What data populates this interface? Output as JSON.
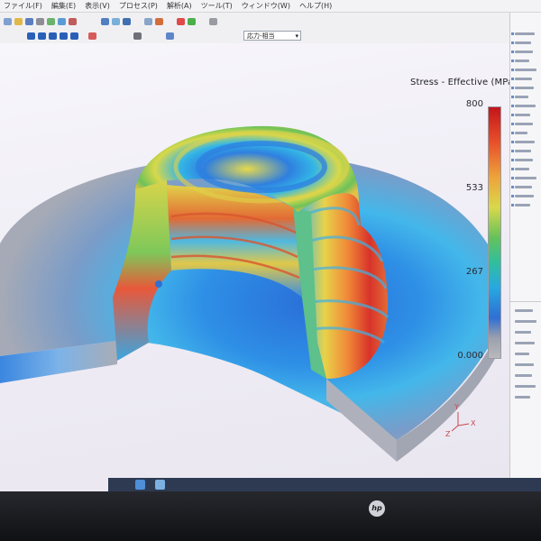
{
  "menu": {
    "items": [
      "ファイル(F)",
      "編集(E)",
      "表示(V)",
      "プロセス(P)",
      "解析(A)",
      "ツール(T)",
      "ウィンドウ(W)",
      "ヘルプ(H)"
    ]
  },
  "toolbar": {
    "result_dropdown": "応力-相当"
  },
  "legend": {
    "title": "Stress - Effective (MPa)",
    "max_label": "800",
    "mid_high_label": "533",
    "mid_low_label": "267",
    "min_label": "0.000",
    "colors": [
      "#c4151a",
      "#eea33a",
      "#d9d84a",
      "#64c25a",
      "#27a8e2",
      "#2f6fd4",
      "#b9b9bd"
    ]
  },
  "axes": {
    "x": "X",
    "y": "Y",
    "z": "Z"
  },
  "monitor": {
    "brand": "hp"
  }
}
